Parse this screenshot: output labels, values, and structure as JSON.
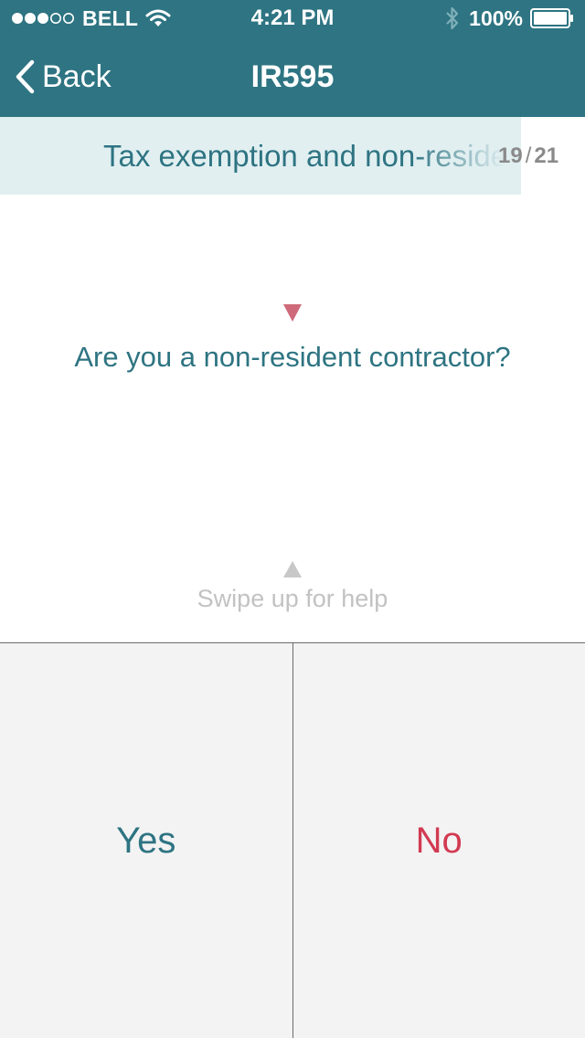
{
  "status_bar": {
    "carrier": "BELL",
    "time": "4:21 PM",
    "battery": "100%",
    "signal_icon": "signal-dots-icon",
    "wifi_icon": "wifi-icon",
    "bluetooth_icon": "bluetooth-icon",
    "battery_icon": "battery-icon"
  },
  "nav": {
    "back_label": "Back",
    "title": "IR595"
  },
  "section": {
    "title": "Tax exemption and non-resident contractor",
    "current": "19",
    "separator": "/",
    "total": "21"
  },
  "question": {
    "text": "Are you a non-resident contractor?"
  },
  "help": {
    "text": "Swipe up for help"
  },
  "answers": {
    "yes": "Yes",
    "no": "No"
  },
  "colors": {
    "accent": "#2e7482",
    "marker": "#cf6a7a",
    "no": "#d23a52",
    "help": "#c2c2c2",
    "section_bg": "#e1eff1",
    "answer_bg": "#f3f3f3"
  }
}
